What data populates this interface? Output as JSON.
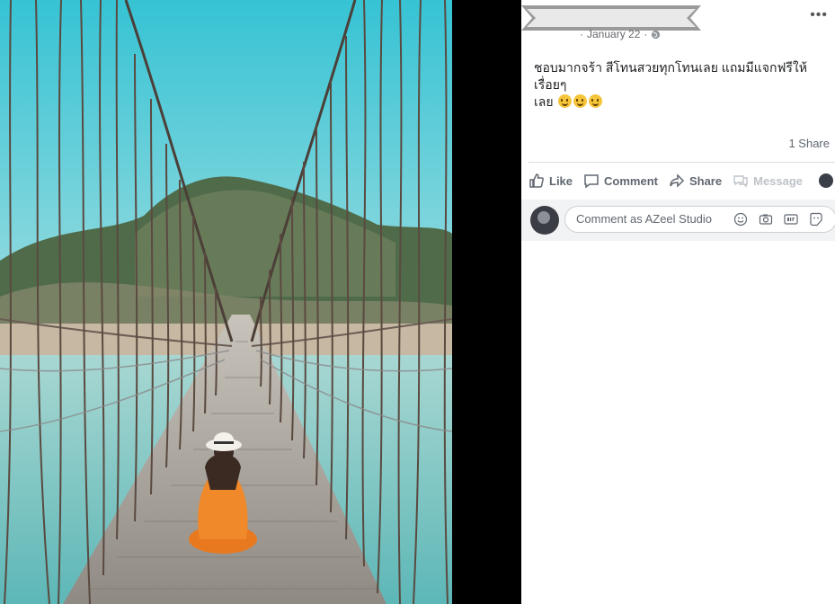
{
  "post": {
    "date": "January 22",
    "separator": "·",
    "text_line1": "ชอบมากจร้า สีโทนสวยทุกโทนเลย แถมมีแจกฟรีให้เรื่อยๆ",
    "text_line2": "เลย",
    "emoji_count": 3,
    "shares": "1 Share",
    "more_label": "•••"
  },
  "actions": {
    "like": "Like",
    "comment": "Comment",
    "share": "Share",
    "message": "Message"
  },
  "comment_box": {
    "placeholder": "Comment as AZeel Studio"
  },
  "icons": {
    "privacy": "globe-icon",
    "like": "thumbs-up-icon",
    "comment": "speech-bubble-icon",
    "share": "share-arrow-icon",
    "message": "messenger-bubble-icon",
    "emoji": "smiley-icon",
    "camera": "camera-icon",
    "gif": "gif-icon",
    "sticker": "sticker-icon",
    "dropdown": "caret-down-icon"
  },
  "colors": {
    "sky": "#3ec3d3",
    "water": "#7fc6c4",
    "dress": "#f0892a",
    "text": "#1c1e21",
    "muted": "#606770"
  }
}
